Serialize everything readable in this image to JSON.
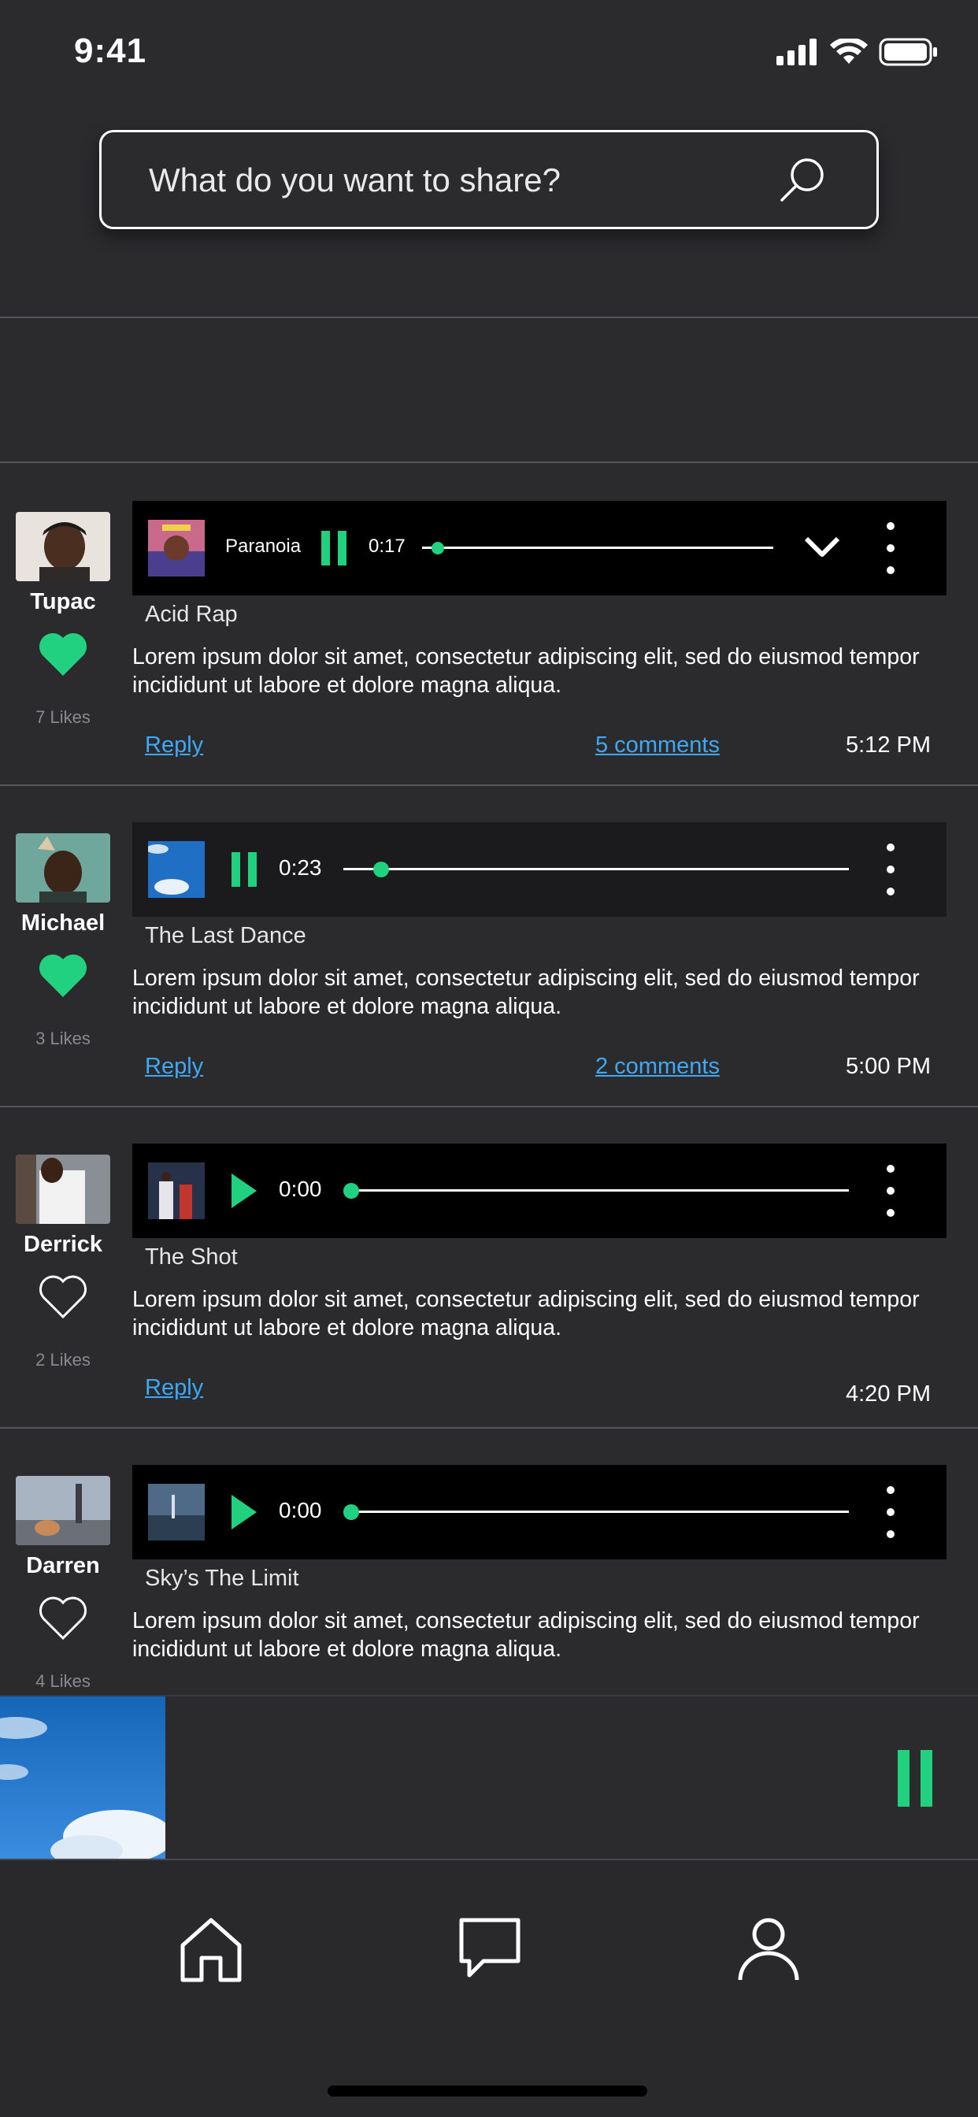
{
  "status": {
    "time": "9:41"
  },
  "search": {
    "placeholder": "What do you want to share?"
  },
  "colors": {
    "accent": "#22d17f",
    "link": "#3ea8f5",
    "background": "#2b2b2e"
  },
  "posts": [
    {
      "user": "Tupac",
      "likes": "7 Likes",
      "liked": true,
      "player": {
        "track": "Paranoia",
        "state": "playing",
        "time": "0:17",
        "progress": 0.04
      },
      "song": "Acid Rap",
      "body": "Lorem ipsum dolor sit amet, consectetur adipiscing elit, sed do eiusmod tempor incididunt ut labore et dolore magna aliqua.",
      "reply": "Reply",
      "comments": "5 comments",
      "time": "5:12 PM"
    },
    {
      "user": "Michael",
      "likes": "3 Likes",
      "liked": true,
      "player": {
        "state": "playing",
        "time": "0:23",
        "progress": 0.08
      },
      "song": "The Last Dance",
      "body": "Lorem ipsum dolor sit amet, consectetur adipiscing elit, sed do eiusmod tempor incididunt ut labore et dolore magna aliqua.",
      "reply": "Reply",
      "comments": "2 comments",
      "time": "5:00 PM"
    },
    {
      "user": "Derrick",
      "likes": "2 Likes",
      "liked": false,
      "player": {
        "state": "paused",
        "time": "0:00",
        "progress": 0
      },
      "song": "The Shot",
      "body": "Lorem ipsum dolor sit amet, consectetur adipiscing elit, sed do eiusmod tempor incididunt ut labore et dolore magna aliqua.",
      "reply": "Reply",
      "time": "4:20 PM"
    },
    {
      "user": "Darren",
      "likes": "4 Likes",
      "liked": false,
      "player": {
        "state": "paused",
        "time": "0:00",
        "progress": 0
      },
      "song": "Sky’s The Limit",
      "body": "Lorem ipsum dolor sit amet, consectetur adipiscing elit, sed do eiusmod tempor incididunt ut labore et dolore magna aliqua."
    }
  ],
  "now_playing": {
    "state": "playing"
  },
  "tabs": [
    {
      "icon": "home-icon"
    },
    {
      "icon": "chat-icon"
    },
    {
      "icon": "profile-icon"
    }
  ]
}
